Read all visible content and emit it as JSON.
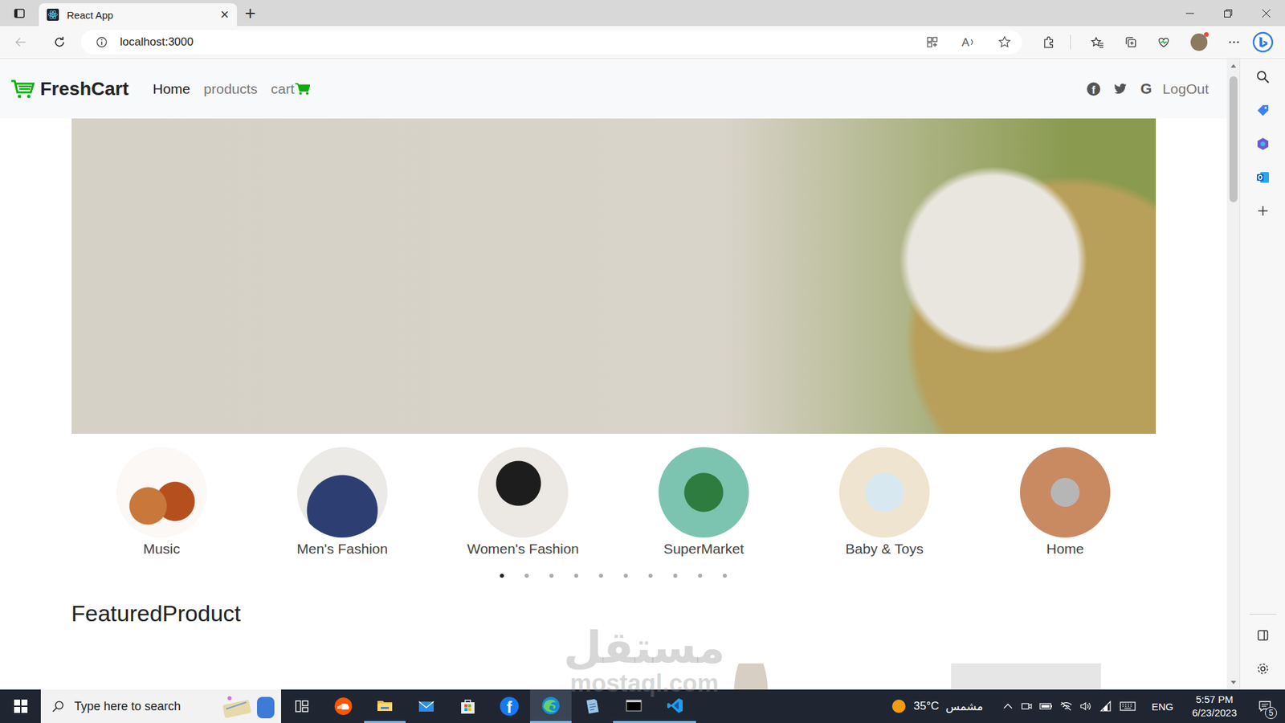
{
  "window": {
    "tab_title": "React App",
    "tab_close": "×",
    "new_tab": "+"
  },
  "toolbar": {
    "url": "localhost:3000",
    "read_aloud_glyph": "A"
  },
  "navbar": {
    "brand": "FreshCart",
    "links": [
      {
        "label": "Home",
        "selected": true,
        "kind": "link"
      },
      {
        "label": "products",
        "selected": false,
        "kind": "link"
      },
      {
        "label": "cart",
        "selected": false,
        "kind": "cart-link"
      }
    ],
    "social": [
      {
        "kind": "facebook",
        "glyph": "f"
      },
      {
        "kind": "twitter"
      },
      {
        "kind": "google",
        "glyph": "G"
      }
    ],
    "logout": "LogOut"
  },
  "categories": [
    {
      "name": "Music"
    },
    {
      "name": "Men's Fashion"
    },
    {
      "name": "Women's Fashion"
    },
    {
      "name": "SuperMarket"
    },
    {
      "name": "Baby & Toys"
    },
    {
      "name": "Home"
    }
  ],
  "carousel_dots": [
    {
      "selected": true
    },
    {
      "selected": false
    },
    {
      "selected": false
    },
    {
      "selected": false
    },
    {
      "selected": false
    },
    {
      "selected": false
    },
    {
      "selected": false
    },
    {
      "selected": false
    },
    {
      "selected": false
    },
    {
      "selected": false
    }
  ],
  "section_title": "FeaturedProduct",
  "watermark": {
    "arabic": "مستقل",
    "latin": "mostaql.com"
  },
  "taskbar": {
    "search_placeholder": "Type here to search",
    "apps": [
      {
        "kind": "task-view",
        "open": false,
        "selected": false
      },
      {
        "kind": "soundcloud",
        "open": false,
        "selected": false
      },
      {
        "kind": "explorer",
        "open": true,
        "selected": false
      },
      {
        "kind": "mail",
        "open": false,
        "selected": false
      },
      {
        "kind": "store",
        "open": false,
        "selected": false
      },
      {
        "kind": "facebook",
        "glyph": "f",
        "open": false,
        "selected": false
      },
      {
        "kind": "edge",
        "open": true,
        "selected": true
      },
      {
        "kind": "notes",
        "open": false,
        "selected": false
      },
      {
        "kind": "terminal",
        "open": true,
        "selected": false
      },
      {
        "kind": "vscode",
        "open": true,
        "selected": false
      }
    ],
    "weather": {
      "temp": "35°C",
      "condition": "مشمس"
    },
    "language": "ENG",
    "time": "5:57 PM",
    "date": "6/23/2023",
    "notifications": "5"
  }
}
